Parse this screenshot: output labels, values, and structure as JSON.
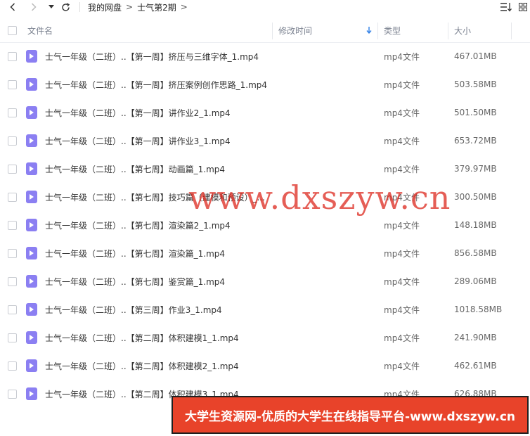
{
  "breadcrumb": {
    "root": "我的网盘",
    "current": "士气第2期",
    "sep": ">"
  },
  "header": {
    "name": "文件名",
    "modified": "修改时间",
    "type": "类型",
    "size": "大小"
  },
  "files": [
    {
      "name": "士气一年级（二班）..【第一周】挤压与三维字体_1.mp4",
      "type": "mp4文件",
      "size": "467.01MB"
    },
    {
      "name": "士气一年级（二班）..【第一周】挤压案例创作思路_1.mp4",
      "type": "mp4文件",
      "size": "503.58MB"
    },
    {
      "name": "士气一年级（二班）..【第一周】讲作业2_1.mp4",
      "type": "mp4文件",
      "size": "501.50MB"
    },
    {
      "name": "士气一年级（二班）..【第一周】讲作业3_1.mp4",
      "type": "mp4文件",
      "size": "653.72MB"
    },
    {
      "name": "士气一年级（二班）..【第七周】动画篇_1.mp4",
      "type": "mp4文件",
      "size": "379.97MB"
    },
    {
      "name": "士气一年级（二班）..【第七周】技巧篇（建模和预设）_...",
      "type": "mp4文件",
      "size": "300.50MB"
    },
    {
      "name": "士气一年级（二班）..【第七周】渲染篇2_1.mp4",
      "type": "mp4文件",
      "size": "148.18MB"
    },
    {
      "name": "士气一年级（二班）..【第七周】渲染篇_1.mp4",
      "type": "mp4文件",
      "size": "856.58MB"
    },
    {
      "name": "士气一年级（二班）..【第七周】鉴赏篇_1.mp4",
      "type": "mp4文件",
      "size": "289.06MB"
    },
    {
      "name": "士气一年级（二班）..【第三周】作业3_1.mp4",
      "type": "mp4文件",
      "size": "1018.58MB"
    },
    {
      "name": "士气一年级（二班）..【第二周】体积建模1_1.mp4",
      "type": "mp4文件",
      "size": "241.90MB"
    },
    {
      "name": "士气一年级（二班）..【第二周】体积建模2_1.mp4",
      "type": "mp4文件",
      "size": "462.61MB"
    },
    {
      "name": "士气一年级（二班）..【第二周】体积建模3_1.mp4",
      "type": "mp4文件",
      "size": "626.88MB"
    }
  ],
  "watermark": "www.dxszyw.cn",
  "banner": "大学生资源网-优质的大学生在线指导平台-www.dxszyw.cn",
  "colors": {
    "file_icon": "#8b7ff2",
    "banner_bg": "#e8432a",
    "watermark": "#dc281e"
  }
}
